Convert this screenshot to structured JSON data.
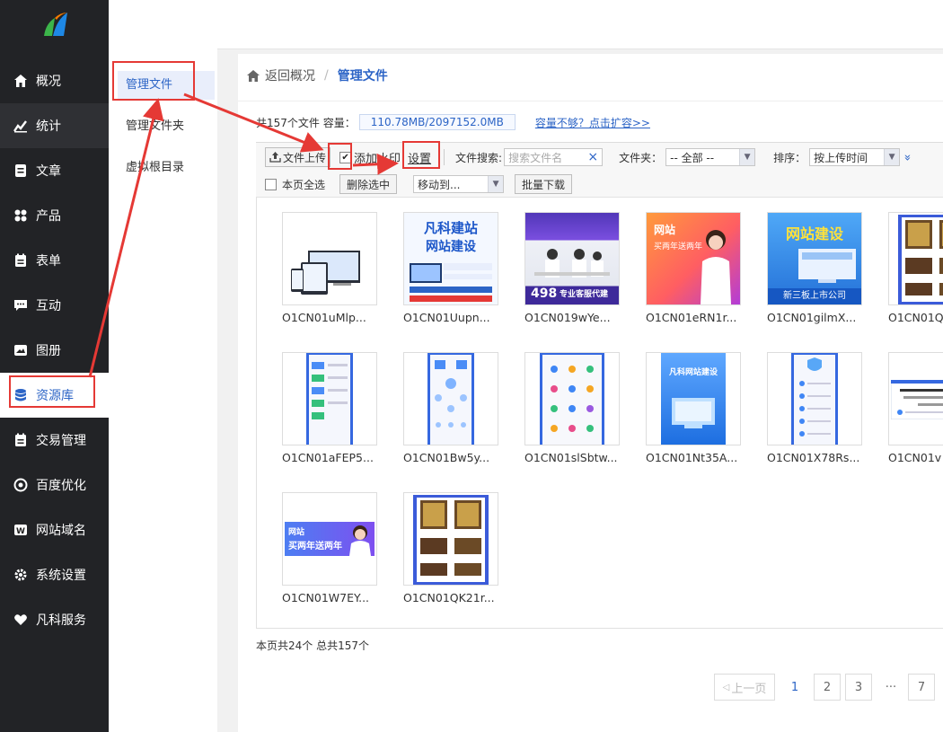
{
  "sidebar": {
    "items": [
      {
        "label": "概况",
        "icon": "home-icon"
      },
      {
        "label": "统计",
        "icon": "chart-icon"
      },
      {
        "label": "文章",
        "icon": "article-icon"
      },
      {
        "label": "产品",
        "icon": "grid-icon"
      },
      {
        "label": "表单",
        "icon": "form-icon"
      },
      {
        "label": "互动",
        "icon": "chat-icon"
      },
      {
        "label": "图册",
        "icon": "album-icon"
      },
      {
        "label": "资源库",
        "icon": "database-icon"
      },
      {
        "label": "交易管理",
        "icon": "trade-icon"
      },
      {
        "label": "百度优化",
        "icon": "target-icon"
      },
      {
        "label": "网站域名",
        "icon": "domain-icon"
      },
      {
        "label": "系统设置",
        "icon": "gear-icon"
      },
      {
        "label": "凡科服务",
        "icon": "heart-icon"
      }
    ]
  },
  "submenu": {
    "items": [
      {
        "label": "管理文件"
      },
      {
        "label": "管理文件夹"
      },
      {
        "label": "虚拟根目录"
      }
    ]
  },
  "breadcrumb": {
    "back": "返回概况",
    "separator": "/",
    "current": "管理文件"
  },
  "capacity": {
    "summary": "共157个文件 容量：",
    "value": "110.78MB/2097152.0MB",
    "expand_link": "容量不够？点击扩容>>"
  },
  "toolbar": {
    "upload": "文件上传",
    "watermark": "添加水印",
    "settings": "设置",
    "search_label": "文件搜索:",
    "search_placeholder": "搜索文件名",
    "clear_glyph": "×",
    "folder_label": "文件夹：",
    "folder_value": "-- 全部 --",
    "sort_label": "排序：",
    "sort_value": "按上传时间",
    "more_glyph": "»",
    "select_all": "本页全选",
    "delete": "删除选中",
    "move": "移动到...",
    "batch_download": "批量下载"
  },
  "files": [
    {
      "name": "O1CN01uMlp...",
      "thumb": "devices"
    },
    {
      "name": "O1CN01Uupn...",
      "thumb": "fanke-ad",
      "title": "凡科建站",
      "subtitle": "网站建设"
    },
    {
      "name": "O1CN019wYe...",
      "thumb": "team-photo",
      "price": "498",
      "tagline": "专业客服代建"
    },
    {
      "name": "O1CN01eRN1r...",
      "thumb": "woman-ad",
      "title": "网站",
      "subtitle": "买两年送两年"
    },
    {
      "name": "O1CN01gilmX...",
      "thumb": "build-ad",
      "title": "网站建设",
      "tagline": "新三板上市公司"
    },
    {
      "name": "O1CN01Q",
      "thumb": "certs"
    },
    {
      "name": "O1CN01aFEP5...",
      "thumb": "phone-list"
    },
    {
      "name": "O1CN01Bw5y...",
      "thumb": "phone-diagram"
    },
    {
      "name": "O1CN01slSbtw...",
      "thumb": "phone-icons"
    },
    {
      "name": "O1CN01Nt35A...",
      "thumb": "blue-web",
      "title": "凡科网站建设"
    },
    {
      "name": "O1CN01X78Rs...",
      "thumb": "phone-shield"
    },
    {
      "name": "O1CN01v",
      "thumb": "popup"
    },
    {
      "name": "O1CN01W7EY...",
      "thumb": "banner",
      "title": "网站",
      "subtitle": "买两年送两年"
    },
    {
      "name": "O1CN01QK21r...",
      "thumb": "certs"
    }
  ],
  "footer": {
    "count": "本页共24个 总共157个"
  },
  "pagination": {
    "prev": "上一页",
    "pages": [
      "1",
      "2",
      "3"
    ],
    "ellipsis": "···",
    "last": "7"
  },
  "colors": {
    "accent": "#2c64c6",
    "sidebar_bg": "#222326",
    "annotation": "#e53935"
  }
}
